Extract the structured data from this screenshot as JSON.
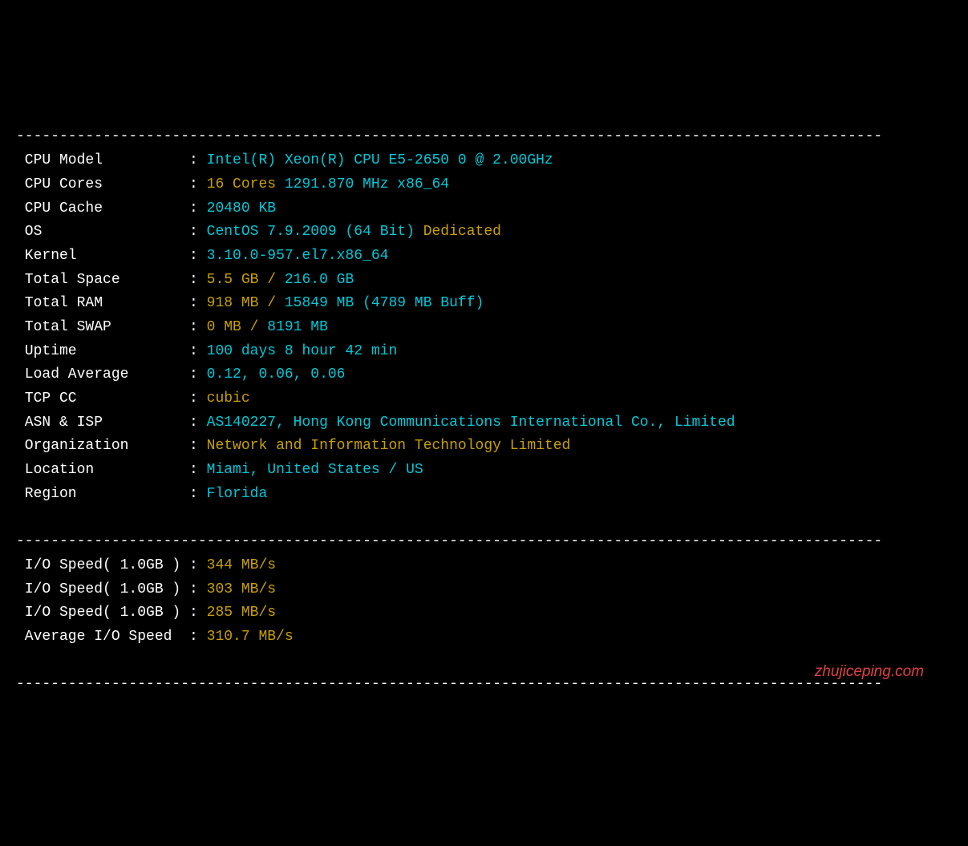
{
  "divider": "----------------------------------------------------------------------------------------------------",
  "rows": [
    {
      "label": " CPU Model          ",
      "parts": [
        {
          "cls": "cyan",
          "text": "Intel(R) Xeon(R) CPU E5-2650 0 @ 2.00GHz"
        }
      ]
    },
    {
      "label": " CPU Cores          ",
      "parts": [
        {
          "cls": "yellow",
          "text": "16 Cores "
        },
        {
          "cls": "cyan",
          "text": "1291.870 MHz x86_64"
        }
      ]
    },
    {
      "label": " CPU Cache          ",
      "parts": [
        {
          "cls": "cyan",
          "text": "20480 KB"
        }
      ]
    },
    {
      "label": " OS                 ",
      "parts": [
        {
          "cls": "cyan",
          "text": "CentOS 7.9.2009 (64 Bit) "
        },
        {
          "cls": "yellow",
          "text": "Dedicated"
        }
      ]
    },
    {
      "label": " Kernel             ",
      "parts": [
        {
          "cls": "cyan",
          "text": "3.10.0-957.el7.x86_64"
        }
      ]
    },
    {
      "label": " Total Space        ",
      "parts": [
        {
          "cls": "yellow",
          "text": "5.5 GB / "
        },
        {
          "cls": "cyan",
          "text": "216.0 GB"
        }
      ]
    },
    {
      "label": " Total RAM          ",
      "parts": [
        {
          "cls": "yellow",
          "text": "918 MB / "
        },
        {
          "cls": "cyan",
          "text": "15849 MB "
        },
        {
          "cls": "cyan",
          "text": "(4789 MB Buff)"
        }
      ]
    },
    {
      "label": " Total SWAP         ",
      "parts": [
        {
          "cls": "yellow",
          "text": "0 MB / "
        },
        {
          "cls": "cyan",
          "text": "8191 MB"
        }
      ]
    },
    {
      "label": " Uptime             ",
      "parts": [
        {
          "cls": "cyan",
          "text": "100 days 8 hour 42 min"
        }
      ]
    },
    {
      "label": " Load Average       ",
      "parts": [
        {
          "cls": "cyan",
          "text": "0.12, 0.06, 0.06"
        }
      ]
    },
    {
      "label": " TCP CC             ",
      "parts": [
        {
          "cls": "yellow",
          "text": "cubic"
        }
      ]
    },
    {
      "label": " ASN & ISP          ",
      "parts": [
        {
          "cls": "cyan",
          "text": "AS140227, Hong Kong Communications International Co., Limited"
        }
      ]
    },
    {
      "label": " Organization       ",
      "parts": [
        {
          "cls": "yellow",
          "text": "Network and Information Technology Limited"
        }
      ]
    },
    {
      "label": " Location           ",
      "parts": [
        {
          "cls": "cyan",
          "text": "Miami, United States / US"
        }
      ]
    },
    {
      "label": " Region             ",
      "parts": [
        {
          "cls": "cyan",
          "text": "Florida"
        }
      ]
    }
  ],
  "io_rows": [
    {
      "label": " I/O Speed( 1.0GB ) ",
      "parts": [
        {
          "cls": "yellow",
          "text": "344 MB/s"
        }
      ]
    },
    {
      "label": " I/O Speed( 1.0GB ) ",
      "parts": [
        {
          "cls": "yellow",
          "text": "303 MB/s"
        }
      ]
    },
    {
      "label": " I/O Speed( 1.0GB ) ",
      "parts": [
        {
          "cls": "yellow",
          "text": "285 MB/s"
        }
      ]
    },
    {
      "label": " Average I/O Speed  ",
      "parts": [
        {
          "cls": "yellow",
          "text": "310.7 MB/s"
        }
      ]
    }
  ],
  "watermark": "zhujiceping.com"
}
